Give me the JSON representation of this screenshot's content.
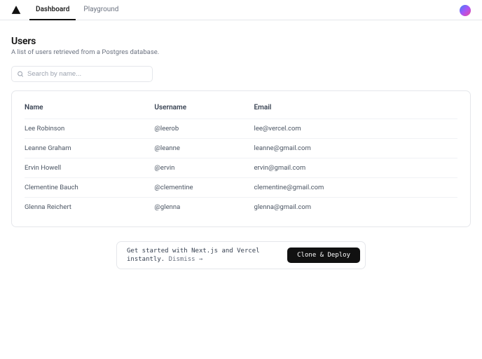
{
  "nav": {
    "items": [
      {
        "label": "Dashboard",
        "active": true
      },
      {
        "label": "Playground",
        "active": false
      }
    ]
  },
  "page": {
    "title": "Users",
    "subtitle": "A list of users retrieved from a Postgres database."
  },
  "search": {
    "placeholder": "Search by name..."
  },
  "table": {
    "headers": {
      "name": "Name",
      "username": "Username",
      "email": "Email"
    },
    "rows": [
      {
        "name": "Lee Robinson",
        "username": "@leerob",
        "email": "lee@vercel.com"
      },
      {
        "name": "Leanne Graham",
        "username": "@leanne",
        "email": "leanne@gmail.com"
      },
      {
        "name": "Ervin Howell",
        "username": "@ervin",
        "email": "ervin@gmail.com"
      },
      {
        "name": "Clementine Bauch",
        "username": "@clementine",
        "email": "clementine@gmail.com"
      },
      {
        "name": "Glenna Reichert",
        "username": "@glenna",
        "email": "glenna@gmail.com"
      }
    ]
  },
  "banner": {
    "line1": "Get started with Next.js and Vercel",
    "line2_prefix": "instantly. ",
    "dismiss": "Dismiss →",
    "button": "Clone & Deploy"
  }
}
